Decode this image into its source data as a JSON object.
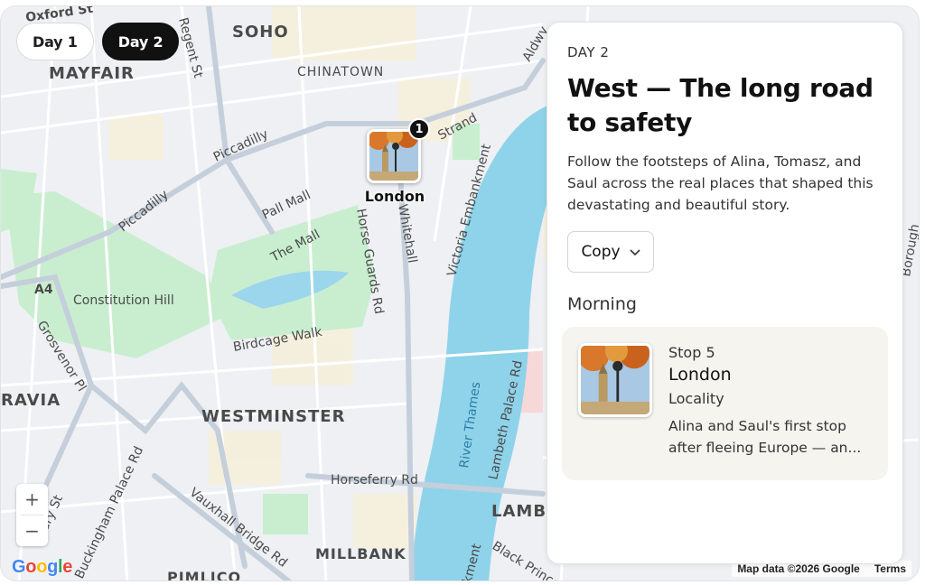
{
  "day_tabs": [
    {
      "label": "Day 1",
      "active": false
    },
    {
      "label": "Day 2",
      "active": true
    }
  ],
  "map": {
    "labels": {
      "oxford_st": "Oxford St",
      "soho": "SOHO",
      "mayfair": "MAYFAIR",
      "chinatown": "CHINATOWN",
      "regent_st": "Regent St",
      "piccadilly_top": "Piccadilly",
      "piccadilly_left": "Piccadilly",
      "pall_mall": "Pall Mall",
      "strand": "Strand",
      "the_mall": "The Mall",
      "whitehall": "Whitehall",
      "horse_guards": "Horse Guards Rd",
      "victoria_emb": "Victoria Embankment",
      "a4": "A4",
      "constitution": "Constitution Hill",
      "grosvenor": "Grosvenor Pl",
      "birdcage": "Birdcage Walk",
      "gravia": "RAVIA",
      "westminster": "WESTMINSTER",
      "river": "River Thames",
      "lambeth_palace": "Lambeth Palace Rd",
      "horseferry": "Horseferry Rd",
      "lamb": "LAMB",
      "buckingham": "Buckingham Palace Rd",
      "bury": "bury St",
      "vauxhall": "Vauxhall Bridge Rd",
      "millbank": "MILLBANK",
      "black_prince": "Black Prince Rd",
      "pimlico": "PIMLICO",
      "kment": "kment",
      "aldwych": "Aldwy",
      "borough": "Borough"
    },
    "marker": {
      "badge": "1",
      "label": "London"
    },
    "zoom_in": "+",
    "zoom_out": "−",
    "google": [
      "G",
      "o",
      "o",
      "g",
      "l",
      "e"
    ],
    "google_colors": [
      "#4285F4",
      "#EA4335",
      "#FBBC05",
      "#4285F4",
      "#34A853",
      "#EA4335"
    ],
    "attribution": "Map data ©2026 Google",
    "terms": "Terms"
  },
  "panel": {
    "eyebrow": "DAY 2",
    "title": "West — The long road to safety",
    "description": "Follow the footsteps of Alina, Tomasz, and Saul across the real places that shaped this devastating and beautiful story.",
    "copy_label": "Copy",
    "section": "Morning",
    "card": {
      "stop": "Stop 5",
      "place": "London",
      "type": "Locality",
      "blurb": "Alina and Saul's first stop after fleeing Europe — an..."
    }
  },
  "colors": {
    "water": "#8fd3ea",
    "park": "#c9eecf",
    "road": "#ffffff",
    "major_road": "#c5cfdb",
    "accent_dark": "#111111"
  }
}
